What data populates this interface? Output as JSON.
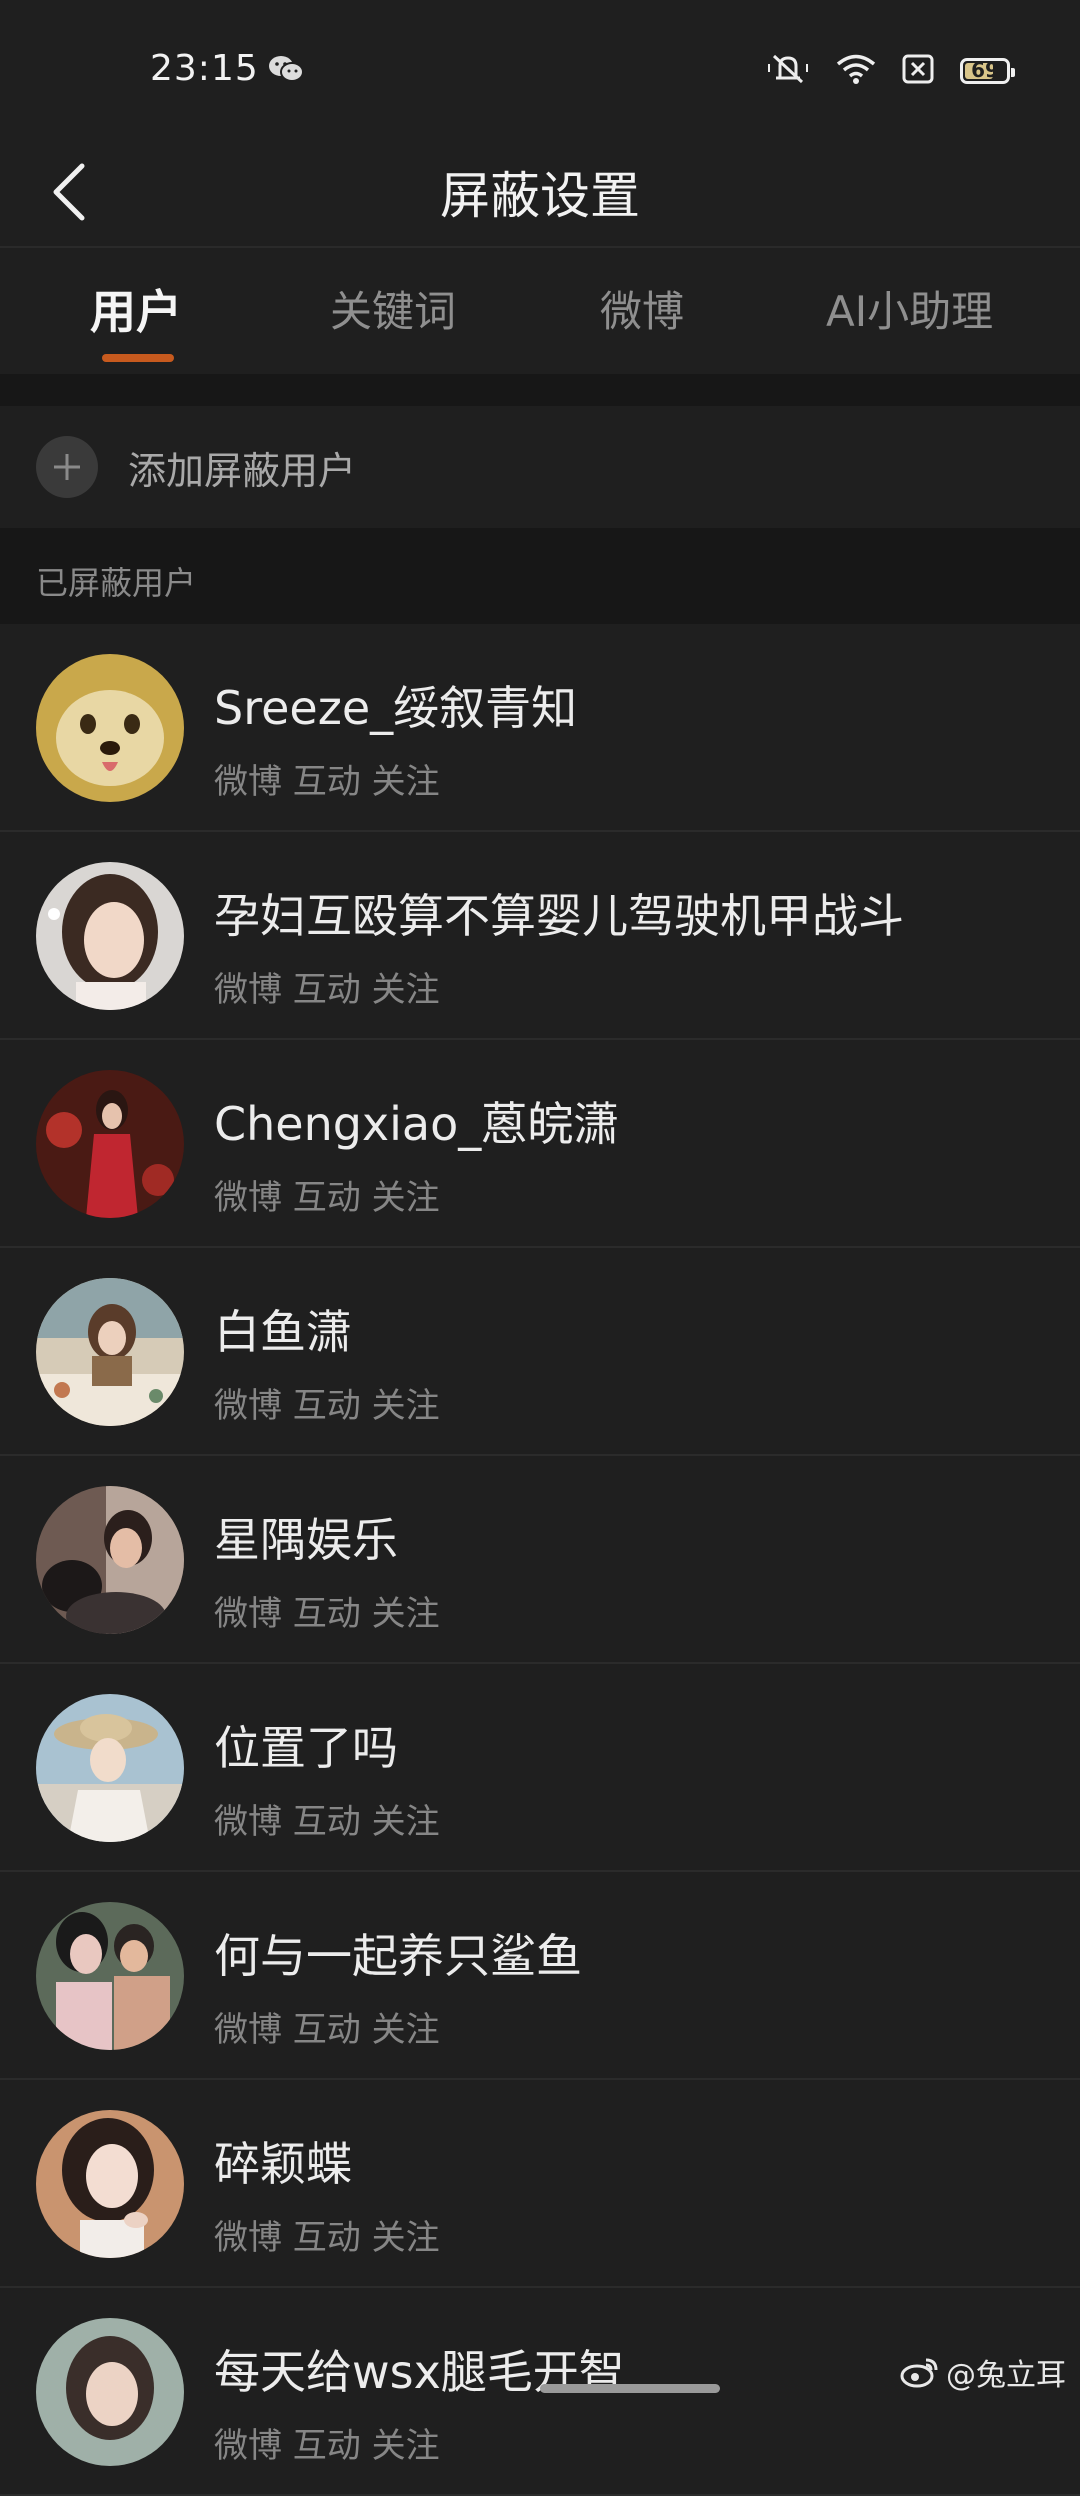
{
  "status_bar": {
    "time": "23:15",
    "battery": "69",
    "icons": [
      "wechat-icon",
      "mute-icon",
      "wifi-icon",
      "sim-x-icon",
      "battery-icon"
    ]
  },
  "header": {
    "title": "屏蔽设置",
    "back_icon": "chevron-left-icon"
  },
  "tabs": [
    {
      "label": "用户",
      "active": true
    },
    {
      "label": "关键词",
      "active": false
    },
    {
      "label": "微博",
      "active": false
    },
    {
      "label": "AI小助理",
      "active": false
    }
  ],
  "add_row": {
    "label": "添加屏蔽用户",
    "icon": "plus-icon"
  },
  "section": {
    "label": "已屏蔽用户"
  },
  "users": [
    {
      "name": "Sreeze_绥叙青知",
      "meta": "微博 互动 关注"
    },
    {
      "name": "孕妇互殴算不算婴儿驾驶机甲战斗",
      "meta": "微博 互动 关注"
    },
    {
      "name": "Chengxiao_蒽皖潇",
      "meta": "微博 互动 关注"
    },
    {
      "name": "白鱼潇",
      "meta": "微博 互动 关注"
    },
    {
      "name": "星隅娱乐",
      "meta": "微博 互动 关注"
    },
    {
      "name": "位置了吗",
      "meta": "微博 互动 关注"
    },
    {
      "name": "何与一起养只鲨鱼",
      "meta": "微博 互动 关注"
    },
    {
      "name": "碎颖蝶",
      "meta": "微博 互动 关注"
    },
    {
      "name": "每天给wsx腿毛开智",
      "meta": "微博 互动 关注"
    }
  ],
  "watermark": "@兔立耳",
  "colors": {
    "background": "#1f1f1f",
    "accent": "#c75a1e"
  }
}
